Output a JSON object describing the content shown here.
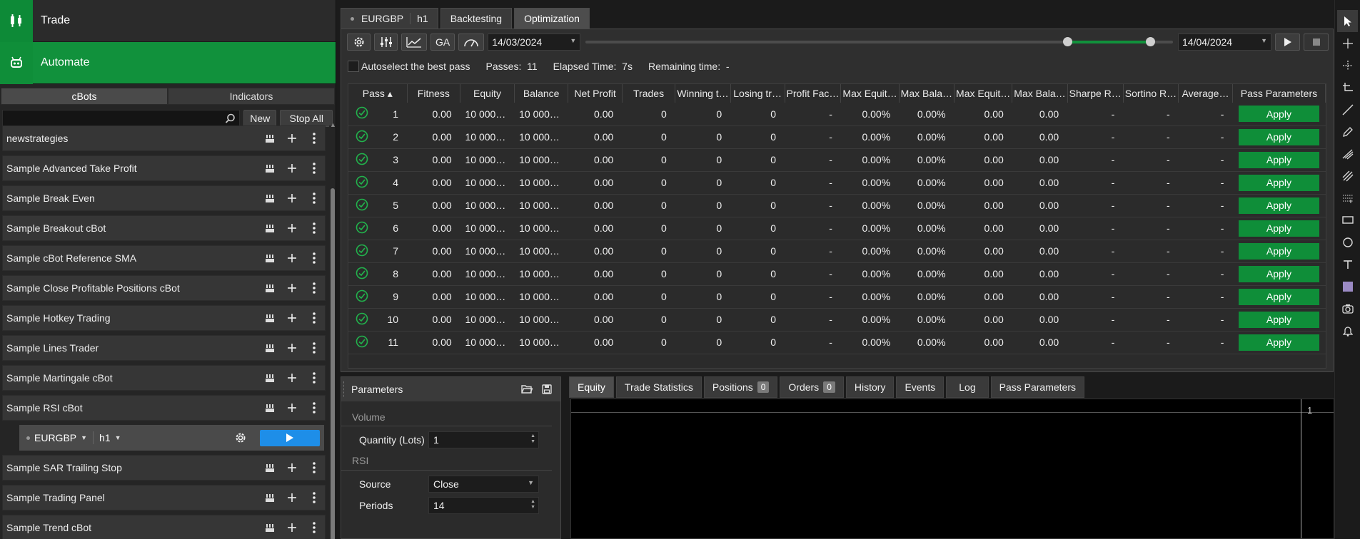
{
  "nav": {
    "trade": "Trade",
    "automate": "Automate"
  },
  "sidebar": {
    "tabs": [
      "cBots",
      "Indicators"
    ],
    "new_label": "New",
    "stop_all_label": "Stop All",
    "bots": [
      "newstrategies",
      "Sample Advanced Take Profit",
      "Sample Break Even",
      "Sample Breakout cBot",
      "Sample cBot Reference SMA",
      "Sample Close Profitable Positions cBot",
      "Sample Hotkey Trading",
      "Sample Lines Trader",
      "Sample Martingale cBot",
      "Sample RSI cBot",
      "Sample SAR Trailing Stop",
      "Sample Trading Panel",
      "Sample Trend cBot"
    ],
    "instance": {
      "symbol": "EURGBP",
      "timeframe": "h1"
    }
  },
  "top_tabs": {
    "symbol": "EURGBP",
    "timeframe": "h1",
    "backtesting": "Backtesting",
    "optimization": "Optimization"
  },
  "toolbar": {
    "ga": "GA",
    "start_date": "14/03/2024",
    "end_date": "14/04/2024"
  },
  "info": {
    "autoselect": "Autoselect the best pass",
    "passes": "Passes:  11",
    "elapsed": "Elapsed Time:  7s",
    "remaining": "Remaining time:  -"
  },
  "table": {
    "headers": [
      "Pass ▴",
      "Fitness",
      "Equity",
      "Balance",
      "Net Profit",
      "Trades",
      "Winning t…",
      "Losing tr…",
      "Profit Fac…",
      "Max Equit…",
      "Max Bala…",
      "Max Equit…",
      "Max Bala…",
      "Sharpe R…",
      "Sortino R…",
      "Average…",
      "Pass Parameters"
    ],
    "apply_label": "Apply",
    "rows": [
      [
        "1",
        "0.00",
        "10 000…",
        "10 000…",
        "0.00",
        "0",
        "0",
        "0",
        "-",
        "0.00%",
        "0.00%",
        "0.00",
        "0.00",
        "-",
        "-",
        "-"
      ],
      [
        "2",
        "0.00",
        "10 000…",
        "10 000…",
        "0.00",
        "0",
        "0",
        "0",
        "-",
        "0.00%",
        "0.00%",
        "0.00",
        "0.00",
        "-",
        "-",
        "-"
      ],
      [
        "3",
        "0.00",
        "10 000…",
        "10 000…",
        "0.00",
        "0",
        "0",
        "0",
        "-",
        "0.00%",
        "0.00%",
        "0.00",
        "0.00",
        "-",
        "-",
        "-"
      ],
      [
        "4",
        "0.00",
        "10 000…",
        "10 000…",
        "0.00",
        "0",
        "0",
        "0",
        "-",
        "0.00%",
        "0.00%",
        "0.00",
        "0.00",
        "-",
        "-",
        "-"
      ],
      [
        "5",
        "0.00",
        "10 000…",
        "10 000…",
        "0.00",
        "0",
        "0",
        "0",
        "-",
        "0.00%",
        "0.00%",
        "0.00",
        "0.00",
        "-",
        "-",
        "-"
      ],
      [
        "6",
        "0.00",
        "10 000…",
        "10 000…",
        "0.00",
        "0",
        "0",
        "0",
        "-",
        "0.00%",
        "0.00%",
        "0.00",
        "0.00",
        "-",
        "-",
        "-"
      ],
      [
        "7",
        "0.00",
        "10 000…",
        "10 000…",
        "0.00",
        "0",
        "0",
        "0",
        "-",
        "0.00%",
        "0.00%",
        "0.00",
        "0.00",
        "-",
        "-",
        "-"
      ],
      [
        "8",
        "0.00",
        "10 000…",
        "10 000…",
        "0.00",
        "0",
        "0",
        "0",
        "-",
        "0.00%",
        "0.00%",
        "0.00",
        "0.00",
        "-",
        "-",
        "-"
      ],
      [
        "9",
        "0.00",
        "10 000…",
        "10 000…",
        "0.00",
        "0",
        "0",
        "0",
        "-",
        "0.00%",
        "0.00%",
        "0.00",
        "0.00",
        "-",
        "-",
        "-"
      ],
      [
        "10",
        "0.00",
        "10 000…",
        "10 000…",
        "0.00",
        "0",
        "0",
        "0",
        "-",
        "0.00%",
        "0.00%",
        "0.00",
        "0.00",
        "-",
        "-",
        "-"
      ],
      [
        "11",
        "0.00",
        "10 000…",
        "10 000…",
        "0.00",
        "0",
        "0",
        "0",
        "-",
        "0.00%",
        "0.00%",
        "0.00",
        "0.00",
        "-",
        "-",
        "-"
      ]
    ]
  },
  "params": {
    "title": "Parameters",
    "volume_section": "Volume",
    "quantity_label": "Quantity (Lots)",
    "quantity_value": "1",
    "rsi_section": "RSI",
    "source_label": "Source",
    "source_value": "Close",
    "periods_label": "Periods",
    "periods_value": "14"
  },
  "bottom_tabs": {
    "equity": "Equity",
    "trade_stats": "Trade Statistics",
    "positions": "Positions",
    "positions_count": "0",
    "orders": "Orders",
    "orders_count": "0",
    "history": "History",
    "events": "Events",
    "log": "Log",
    "pass_params": "Pass Parameters"
  },
  "chart": {
    "axis_label": "1"
  },
  "colors": {
    "accent_green": "#11913c",
    "play_blue": "#1e8ee8"
  }
}
